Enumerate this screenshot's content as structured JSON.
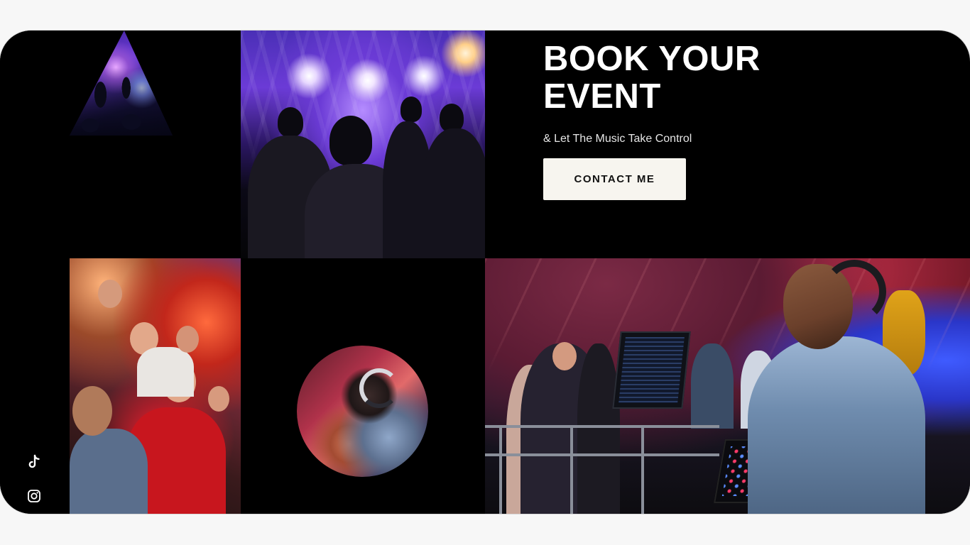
{
  "hero": {
    "headline": "BOOK YOUR EVENT",
    "subline": "& Let The Music Take Control",
    "cta_label": "CONTACT ME"
  },
  "social": {
    "items": [
      {
        "name": "tiktok",
        "icon": "tiktok-icon"
      },
      {
        "name": "instagram",
        "icon": "instagram-icon"
      }
    ]
  },
  "gallery": {
    "images": [
      {
        "name": "triangle-crowd-photo",
        "shape": "triangle"
      },
      {
        "name": "concert-stage-photo",
        "shape": "rectangle"
      },
      {
        "name": "party-crowd-photo",
        "shape": "rectangle"
      },
      {
        "name": "dj-headphones-photo",
        "shape": "circle"
      },
      {
        "name": "dj-performing-photo",
        "shape": "rectangle"
      }
    ]
  },
  "colors": {
    "background": "#f7f7f7",
    "card": "#000000",
    "button_bg": "#f7f5ef",
    "button_text": "#111111",
    "headline": "#ffffff"
  }
}
